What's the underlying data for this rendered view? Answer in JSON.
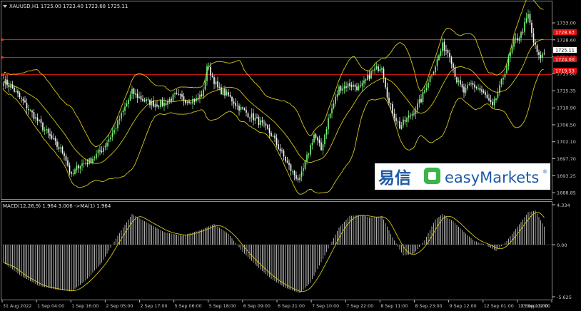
{
  "main_panel": {
    "symbol_line": "XAUUSD,H1  1725.00 1723.40 1723.68 1725.11",
    "price_ticks": [
      "1733.00",
      "1728.60",
      "1724.15",
      "1719.80",
      "1715.35",
      "1710.90",
      "1706.50",
      "1702.10",
      "1697.70",
      "1693.25",
      "1688.85"
    ],
    "levels": [
      {
        "price_label": "1728.63",
        "color": "#ff1a1a"
      },
      {
        "price_label": "1724.00",
        "color": "#ff1a1a"
      },
      {
        "price_label": "1719.53",
        "color": "#ff1a1a"
      }
    ],
    "current_price_label": "1725.11"
  },
  "macd_panel": {
    "label": "MACD(12,26,9) 1.964 3.006  ->MA(1) 1.964",
    "ticks": [
      "4.334",
      "0.00",
      "-5.625"
    ]
  },
  "time_axis": [
    "31 Aug 2022",
    "1 Sep 04:00",
    "1 Sep 16:00",
    "2 Sep 05:00",
    "2 Sep 17:00",
    "5 Sep 06:00",
    "5 Sep 18:00",
    "6 Sep 09:00",
    "6 Sep 21:00",
    "7 Sep 10:00",
    "7 Sep 22:00",
    "8 Sep 11:00",
    "8 Sep 23:00",
    "9 Sep 12:00",
    "12 Sep 01:00",
    "12 Sep 13:00",
    "13 Sep 02:00"
  ],
  "watermark": {
    "chinese": "易信",
    "brand": "easyMarkets",
    "registered": "®"
  },
  "colors": {
    "background": "#000000",
    "bull": "#7cfc7c",
    "bear": "#ffffff",
    "bands": "#d4c51a",
    "levels": "#ff1a1a",
    "axis": "#c0c0c0",
    "brand_blue": "#1c5aa5",
    "brand_green": "#39b54a"
  },
  "chart_data": {
    "type": "candlestick",
    "title": "XAUUSD,H1",
    "ylim": [
      1687.4,
      1738.2
    ],
    "close_keypoints": [
      [
        0,
        1718
      ],
      [
        5,
        1716
      ],
      [
        10,
        1713
      ],
      [
        15,
        1710
      ],
      [
        20,
        1707
      ],
      [
        25,
        1704
      ],
      [
        30,
        1701
      ],
      [
        34,
        1699
      ],
      [
        38,
        1693
      ],
      [
        42,
        1696
      ],
      [
        48,
        1697
      ],
      [
        55,
        1700
      ],
      [
        62,
        1705
      ],
      [
        68,
        1711
      ],
      [
        72,
        1715
      ],
      [
        78,
        1713
      ],
      [
        84,
        1712
      ],
      [
        90,
        1712
      ],
      [
        96,
        1714
      ],
      [
        102,
        1713
      ],
      [
        108,
        1713
      ],
      [
        112,
        1715
      ],
      [
        114,
        1722
      ],
      [
        120,
        1716
      ],
      [
        126,
        1714
      ],
      [
        132,
        1711
      ],
      [
        138,
        1709
      ],
      [
        144,
        1707
      ],
      [
        150,
        1704
      ],
      [
        156,
        1699
      ],
      [
        162,
        1694
      ],
      [
        166,
        1692
      ],
      [
        170,
        1698
      ],
      [
        174,
        1704
      ],
      [
        178,
        1700
      ],
      [
        182,
        1708
      ],
      [
        188,
        1716
      ],
      [
        194,
        1717
      ],
      [
        200,
        1716
      ],
      [
        206,
        1720
      ],
      [
        212,
        1722
      ],
      [
        216,
        1712
      ],
      [
        222,
        1706
      ],
      [
        226,
        1708
      ],
      [
        230,
        1710
      ],
      [
        234,
        1713
      ],
      [
        238,
        1718
      ],
      [
        242,
        1722
      ],
      [
        246,
        1727
      ],
      [
        250,
        1725
      ],
      [
        254,
        1718
      ],
      [
        258,
        1715
      ],
      [
        262,
        1717
      ],
      [
        266,
        1716
      ],
      [
        270,
        1714
      ],
      [
        274,
        1711
      ],
      [
        278,
        1716
      ],
      [
        282,
        1722
      ],
      [
        286,
        1728
      ],
      [
        290,
        1730
      ],
      [
        294,
        1735
      ],
      [
        297,
        1728
      ],
      [
        300,
        1724
      ],
      [
        303,
        1725
      ]
    ],
    "macd_keypoints": [
      [
        0,
        -2.0
      ],
      [
        10,
        -3.5
      ],
      [
        20,
        -4.6
      ],
      [
        30,
        -5.0
      ],
      [
        38,
        -5.2
      ],
      [
        46,
        -4.0
      ],
      [
        55,
        -2.0
      ],
      [
        64,
        1.0
      ],
      [
        72,
        3.4
      ],
      [
        80,
        2.5
      ],
      [
        90,
        1.4
      ],
      [
        100,
        1.0
      ],
      [
        110,
        1.6
      ],
      [
        118,
        2.3
      ],
      [
        126,
        1.2
      ],
      [
        134,
        -0.8
      ],
      [
        142,
        -2.4
      ],
      [
        150,
        -3.8
      ],
      [
        158,
        -4.8
      ],
      [
        166,
        -5.4
      ],
      [
        172,
        -4.2
      ],
      [
        180,
        -1.2
      ],
      [
        188,
        1.9
      ],
      [
        194,
        3.2
      ],
      [
        200,
        3.3
      ],
      [
        206,
        3.0
      ],
      [
        212,
        3.2
      ],
      [
        218,
        0.8
      ],
      [
        224,
        -1.2
      ],
      [
        230,
        -1.0
      ],
      [
        236,
        0.5
      ],
      [
        242,
        2.8
      ],
      [
        246,
        3.4
      ],
      [
        252,
        2.6
      ],
      [
        258,
        1.4
      ],
      [
        264,
        0.4
      ],
      [
        270,
        0.0
      ],
      [
        276,
        -0.7
      ],
      [
        282,
        0.4
      ],
      [
        288,
        2.0
      ],
      [
        294,
        3.6
      ],
      [
        298,
        3.8
      ],
      [
        303,
        2.0
      ]
    ],
    "macd_signal_lag": 6,
    "band_period": 20,
    "band_std": 2
  }
}
